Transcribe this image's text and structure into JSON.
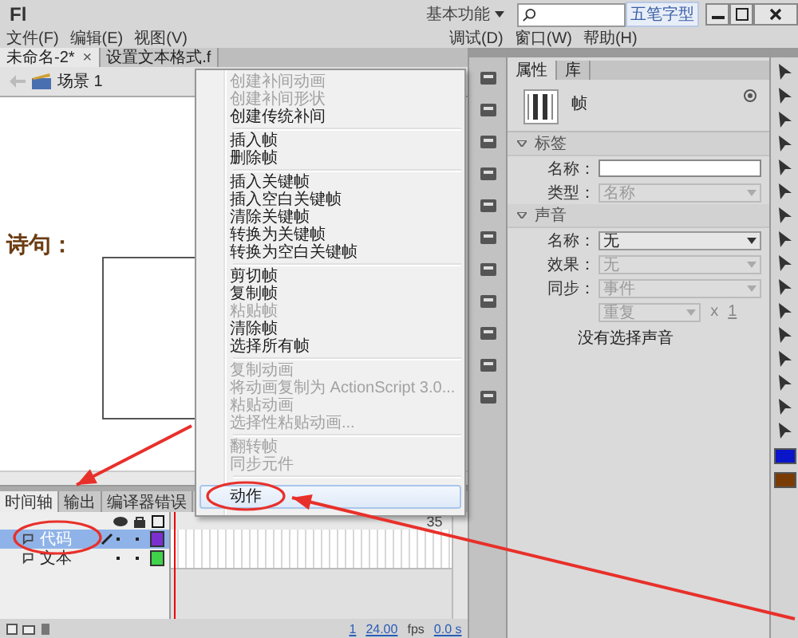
{
  "title_bar": {
    "logo": "Fl",
    "workspace": "基本功能",
    "ime": "五笔字型"
  },
  "menu_bar": {
    "left": [
      "文件(F)",
      "编辑(E)",
      "视图(V)"
    ],
    "right": [
      "调试(D)",
      "窗口(W)",
      "帮助(H)"
    ]
  },
  "documents": {
    "tabs": [
      {
        "label": "未命名-2*",
        "close": "×",
        "selected": true
      },
      {
        "label": "设置文本格式.f",
        "selected": false
      }
    ],
    "scene": "场景 1"
  },
  "stage": {
    "text": "诗句："
  },
  "timeline": {
    "tabs": [
      {
        "label": "时间轴",
        "selected": true
      },
      {
        "label": "输出",
        "selected": false
      },
      {
        "label": "编译器错误",
        "selected": false
      }
    ],
    "layers": [
      {
        "name": "代码",
        "selected": true,
        "color": "#7a2fd0"
      },
      {
        "name": "文本",
        "selected": false,
        "color": "#3fd24a"
      }
    ],
    "frame_label": "35",
    "current_frame": "1",
    "frame_rate": "24.00",
    "fps_unit": "fps",
    "elapsed": "0.0 s"
  },
  "properties": {
    "tabs": [
      {
        "label": "属性",
        "selected": true
      },
      {
        "label": "库",
        "selected": false
      }
    ],
    "object": "帧",
    "sections": [
      {
        "title": "标签",
        "rows": [
          {
            "kind": "input",
            "label": "名称："
          },
          {
            "kind": "select",
            "label": "类型：",
            "value": "名称",
            "disabled": true
          }
        ]
      },
      {
        "title": "声音",
        "rows": [
          {
            "kind": "select",
            "label": "名称：",
            "value": "无",
            "disabled": false
          },
          {
            "kind": "select",
            "label": "效果：",
            "value": "无",
            "disabled": true
          },
          {
            "kind": "select",
            "label": "同步：",
            "value": "事件",
            "disabled": true
          },
          {
            "kind": "repeat",
            "value": "重复",
            "sign": "x",
            "count": "1",
            "disabled": true
          },
          {
            "kind": "note",
            "text": "没有选择声音"
          }
        ]
      }
    ]
  },
  "tools": {
    "swatches": [
      {
        "color": "#0a14c8"
      },
      {
        "color": "#7a3c04"
      }
    ]
  },
  "context_menu": {
    "items": [
      {
        "kind": "item",
        "label": "创建补间动画",
        "disabled": true,
        "selected": false
      },
      {
        "kind": "item",
        "label": "创建补间形状",
        "disabled": true,
        "selected": false
      },
      {
        "kind": "item",
        "label": "创建传统补间",
        "disabled": false,
        "selected": false
      },
      {
        "kind": "separator"
      },
      {
        "kind": "item",
        "label": "插入帧",
        "disabled": false,
        "selected": false
      },
      {
        "kind": "item",
        "label": "删除帧",
        "disabled": false,
        "selected": false
      },
      {
        "kind": "separator"
      },
      {
        "kind": "item",
        "label": "插入关键帧",
        "disabled": false,
        "selected": false
      },
      {
        "kind": "item",
        "label": "插入空白关键帧",
        "disabled": false,
        "selected": false
      },
      {
        "kind": "item",
        "label": "清除关键帧",
        "disabled": false,
        "selected": false
      },
      {
        "kind": "item",
        "label": "转换为关键帧",
        "disabled": false,
        "selected": false
      },
      {
        "kind": "item",
        "label": "转换为空白关键帧",
        "disabled": false,
        "selected": false
      },
      {
        "kind": "separator"
      },
      {
        "kind": "item",
        "label": "剪切帧",
        "disabled": false,
        "selected": false
      },
      {
        "kind": "item",
        "label": "复制帧",
        "disabled": false,
        "selected": false
      },
      {
        "kind": "item",
        "label": "粘贴帧",
        "disabled": true,
        "selected": false
      },
      {
        "kind": "item",
        "label": "清除帧",
        "disabled": false,
        "selected": false
      },
      {
        "kind": "item",
        "label": "选择所有帧",
        "disabled": false,
        "selected": false
      },
      {
        "kind": "separator"
      },
      {
        "kind": "item",
        "label": "复制动画",
        "disabled": true,
        "selected": false
      },
      {
        "kind": "item",
        "label": "将动画复制为 ActionScript 3.0...",
        "disabled": true,
        "selected": false
      },
      {
        "kind": "item",
        "label": "粘贴动画",
        "disabled": true,
        "selected": false
      },
      {
        "kind": "item",
        "label": "选择性粘贴动画...",
        "disabled": true,
        "selected": false
      },
      {
        "kind": "separator"
      },
      {
        "kind": "item",
        "label": "翻转帧",
        "disabled": true,
        "selected": false
      },
      {
        "kind": "item",
        "label": "同步元件",
        "disabled": true,
        "selected": false
      },
      {
        "kind": "separator"
      },
      {
        "kind": "item",
        "label": "动作",
        "disabled": false,
        "selected": true
      }
    ]
  }
}
